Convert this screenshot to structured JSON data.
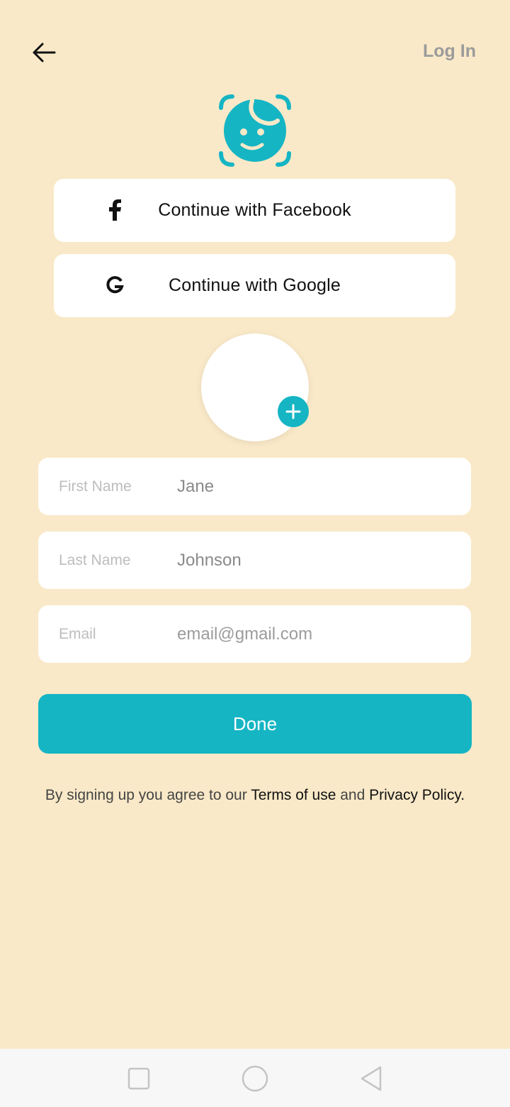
{
  "header": {
    "back_icon": "arrow-left-icon",
    "login_label": "Log In"
  },
  "logo": {
    "icon": "face-scan-logo"
  },
  "social": {
    "facebook_label": "Continue with Facebook",
    "google_label": "Continue with Google"
  },
  "avatar": {
    "add_icon": "plus-icon"
  },
  "form": {
    "first_name": {
      "label": "First Name",
      "value": "Jane"
    },
    "last_name": {
      "label": "Last Name",
      "value": "Johnson"
    },
    "email": {
      "label": "Email",
      "placeholder": "email@gmail.com"
    }
  },
  "done_label": "Done",
  "terms": {
    "prefix": "By signing up you agree to our ",
    "terms_link": "Terms of use",
    "and": " and ",
    "privacy_link": "Privacy Policy."
  },
  "navbar": {
    "recent_icon": "square-icon",
    "home_icon": "circle-icon",
    "back_icon": "triangle-back-icon"
  },
  "colors": {
    "background": "#f9e9c8",
    "accent": "#15b5c4",
    "white": "#ffffff"
  }
}
